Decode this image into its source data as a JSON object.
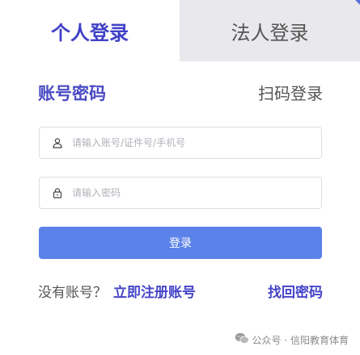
{
  "tabs": {
    "personal_label": "个人登录",
    "legal_label": "法人登录",
    "active": "personal"
  },
  "login_methods": {
    "account_label": "账号密码",
    "qr_label": "扫码登录"
  },
  "form": {
    "account_placeholder": "请输入账号/证件号/手机号",
    "account_value": "",
    "password_placeholder": "请输入密码",
    "password_value": "",
    "submit_label": "登录"
  },
  "footer": {
    "no_account_text": "没有账号？",
    "register_label": "立即注册账号",
    "recover_label": "找回密码"
  },
  "watermark": {
    "text": "公众号 · 信阳教育体育"
  },
  "icons": {
    "account_field": "user-icon",
    "password_field": "lock-icon",
    "watermark": "wechat-icon"
  },
  "colors": {
    "brand": "#4a4ac4",
    "button": "#5b82e8",
    "inactive_tab_bg": "#e9e9ed"
  }
}
